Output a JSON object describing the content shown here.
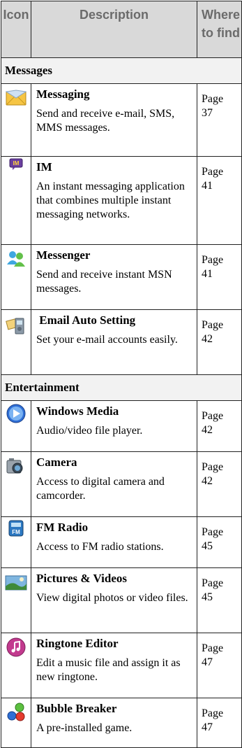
{
  "header": {
    "icon": "Icon",
    "description": "Description",
    "where": "Where to find"
  },
  "sections": [
    {
      "title": "Messages",
      "rows": [
        {
          "icon": "envelope-icon",
          "name": "Messaging",
          "description": "Send and receive e-mail, SMS, MMS messages.",
          "page_word": "Page",
          "page_num": "37"
        },
        {
          "icon": "im-icon",
          "name": "IM",
          "description": "An instant messaging application that combines multiple instant messaging networks.",
          "page_word": "Page",
          "page_num": "41"
        },
        {
          "icon": "messenger-icon",
          "name": "Messenger",
          "description": "Send and receive instant MSN messages.",
          "page_word": "Page",
          "page_num": "41"
        },
        {
          "icon": "email-setting-icon",
          "name": " Email Auto Setting",
          "description": "Set your e-mail accounts easily.",
          "page_word": "Page",
          "page_num": "42"
        }
      ]
    },
    {
      "title": "Entertainment",
      "rows": [
        {
          "icon": "windows-media-icon",
          "name": "Windows Media",
          "description": "Audio/video file player.",
          "page_word": "Page",
          "page_num": "42"
        },
        {
          "icon": "camera-icon",
          "name": "Camera",
          "description": "Access to digital camera and camcorder.",
          "page_word": "Page",
          "page_num": "42"
        },
        {
          "icon": "fm-radio-icon",
          "name": "FM Radio",
          "description": "Access to FM radio stations.",
          "page_word": "Page",
          "page_num": "45"
        },
        {
          "icon": "pictures-icon",
          "name": "Pictures & Videos",
          "description": "View digital photos or video files.",
          "page_word": "Page",
          "page_num": "45"
        },
        {
          "icon": "ringtone-editor-icon",
          "name": "Ringtone Editor",
          "description": "Edit a music file and assign it as new ringtone.",
          "page_word": "Page",
          "page_num": "47"
        },
        {
          "icon": "bubble-breaker-icon",
          "name": "Bubble Breaker",
          "description": "A pre-installed game.",
          "page_word": "Page",
          "page_num": "47"
        }
      ]
    }
  ]
}
